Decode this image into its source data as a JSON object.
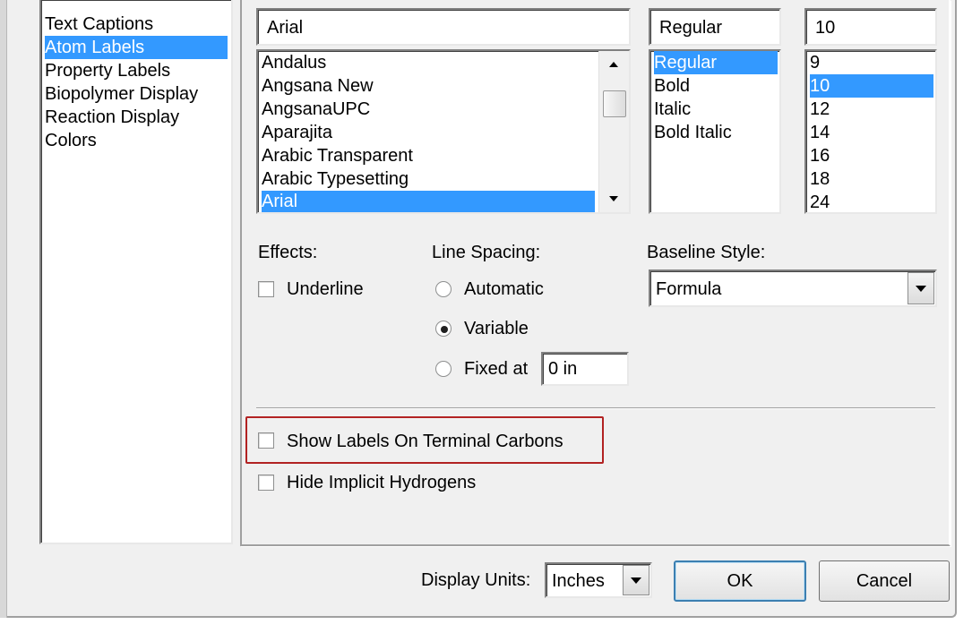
{
  "categories": {
    "items": [
      {
        "label": "Text Captions",
        "selected": false
      },
      {
        "label": "Atom Labels",
        "selected": true
      },
      {
        "label": "Property Labels",
        "selected": false
      },
      {
        "label": "Biopolymer Display",
        "selected": false
      },
      {
        "label": "Reaction Display",
        "selected": false
      },
      {
        "label": "Colors",
        "selected": false
      }
    ]
  },
  "font": {
    "name_value": "Arial",
    "names": [
      "Andalus",
      "Angsana New",
      "AngsanaUPC",
      "Aparajita",
      "Arabic Transparent",
      "Arabic Typesetting",
      "Arial"
    ],
    "selected_name": "Arial",
    "style_value": "Regular",
    "styles": [
      "Regular",
      "Bold",
      "Italic",
      "Bold Italic"
    ],
    "selected_style": "Regular",
    "size_value": "10",
    "sizes": [
      "9",
      "10",
      "12",
      "14",
      "16",
      "18",
      "24"
    ],
    "selected_size": "10"
  },
  "effects": {
    "heading": "Effects:",
    "underline_label": "Underline",
    "underline_checked": false
  },
  "line_spacing": {
    "heading": "Line Spacing:",
    "automatic_label": "Automatic",
    "variable_label": "Variable",
    "fixed_label": "Fixed at",
    "fixed_value": "0 in",
    "selected": "Variable"
  },
  "baseline": {
    "heading": "Baseline Style:",
    "value": "Formula"
  },
  "options": {
    "terminal_carbons_label": "Show Labels On Terminal Carbons",
    "terminal_carbons_checked": false,
    "hide_hydrogens_label": "Hide Implicit Hydrogens",
    "hide_hydrogens_checked": false
  },
  "footer": {
    "units_label": "Display Units:",
    "units_value": "Inches",
    "ok_label": "OK",
    "cancel_label": "Cancel"
  },
  "colors": {
    "selection": "#3399ff",
    "highlight_box": "#b22222",
    "dialog_bg": "#f0f0f0"
  }
}
